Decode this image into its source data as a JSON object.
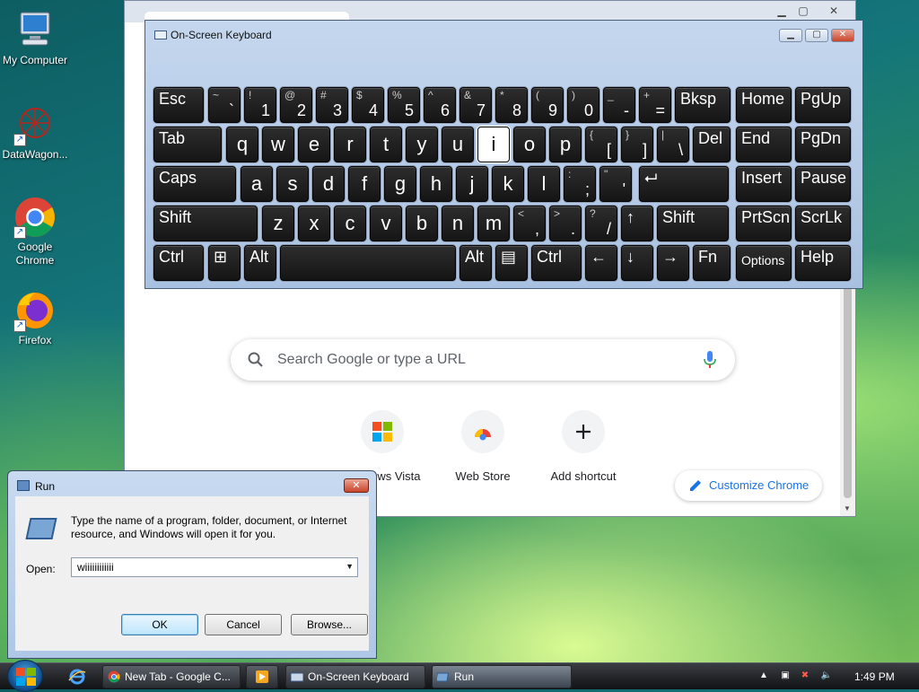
{
  "desktop": {
    "icons": [
      {
        "label": "My Computer"
      },
      {
        "label": "DataWagon..."
      },
      {
        "label": "Google Chrome"
      },
      {
        "label": "Firefox"
      }
    ]
  },
  "chrome": {
    "search_placeholder": "Search Google or type a URL",
    "tiles": [
      {
        "label": "Windows Vista"
      },
      {
        "label": "Web Store"
      },
      {
        "label": "Add shortcut"
      }
    ],
    "customize_label": "Customize Chrome"
  },
  "osk": {
    "title": "On-Screen Keyboard",
    "row1": [
      {
        "l": "Esc"
      },
      {
        "s": "~",
        "m": "`"
      },
      {
        "s": "!",
        "m": "1"
      },
      {
        "s": "@",
        "m": "2"
      },
      {
        "s": "#",
        "m": "3"
      },
      {
        "s": "$",
        "m": "4"
      },
      {
        "s": "%",
        "m": "5"
      },
      {
        "s": "^",
        "m": "6"
      },
      {
        "s": "&",
        "m": "7"
      },
      {
        "s": "*",
        "m": "8"
      },
      {
        "s": "(",
        "m": "9"
      },
      {
        "s": ")",
        "m": "0"
      },
      {
        "s": "_",
        "m": "-"
      },
      {
        "s": "+",
        "m": "="
      },
      {
        "l": "Bksp"
      },
      {
        "l": "Home"
      },
      {
        "l": "PgUp"
      }
    ],
    "row2": [
      {
        "l": "Tab"
      },
      {
        "c": "q"
      },
      {
        "c": "w"
      },
      {
        "c": "e"
      },
      {
        "c": "r"
      },
      {
        "c": "t"
      },
      {
        "c": "y"
      },
      {
        "c": "u"
      },
      {
        "c": "i"
      },
      {
        "c": "o"
      },
      {
        "c": "p"
      },
      {
        "s": "{",
        "m": "["
      },
      {
        "s": "}",
        "m": "]"
      },
      {
        "s": "|",
        "m": "\\"
      },
      {
        "l": "Del"
      },
      {
        "l": "End"
      },
      {
        "l": "PgDn"
      }
    ],
    "row3": [
      {
        "l": "Caps"
      },
      {
        "c": "a"
      },
      {
        "c": "s"
      },
      {
        "c": "d"
      },
      {
        "c": "f"
      },
      {
        "c": "g"
      },
      {
        "c": "h"
      },
      {
        "c": "j"
      },
      {
        "c": "k"
      },
      {
        "c": "l"
      },
      {
        "s": ":",
        "m": ";"
      },
      {
        "s": "\"",
        "m": "'"
      },
      {
        "l": "⮠"
      },
      {
        "l": "Insert"
      },
      {
        "l": "Pause"
      }
    ],
    "row4": [
      {
        "l": "Shift"
      },
      {
        "c": "z"
      },
      {
        "c": "x"
      },
      {
        "c": "c"
      },
      {
        "c": "v"
      },
      {
        "c": "b"
      },
      {
        "c": "n"
      },
      {
        "c": "m"
      },
      {
        "s": "<",
        "m": ","
      },
      {
        "s": ">",
        "m": "."
      },
      {
        "s": "?",
        "m": "/"
      },
      {
        "l": "↑"
      },
      {
        "l": "Shift"
      },
      {
        "l": "PrtScn"
      },
      {
        "l": "ScrLk"
      }
    ],
    "row5": [
      {
        "l": "Ctrl"
      },
      {
        "l": "⊞"
      },
      {
        "l": "Alt"
      },
      {
        "l": ""
      },
      {
        "l": "Alt"
      },
      {
        "l": "▤"
      },
      {
        "l": "Ctrl"
      },
      {
        "l": "←"
      },
      {
        "l": "↓"
      },
      {
        "l": "→"
      },
      {
        "l": "Fn"
      },
      {
        "l": "Options"
      },
      {
        "l": "Help"
      }
    ],
    "active_key": "i"
  },
  "run": {
    "title": "Run",
    "description": "Type the name of a program, folder, document, or Internet resource, and Windows will open it for you.",
    "open_label": "Open:",
    "open_value": "wiiiiiiiiiiii",
    "ok_label": "OK",
    "cancel_label": "Cancel",
    "browse_label": "Browse..."
  },
  "taskbar": {
    "buttons": [
      {
        "label": "New Tab - Google C..."
      },
      {
        "label": "On-Screen Keyboard"
      },
      {
        "label": "Run"
      }
    ],
    "clock": "1:49 PM"
  },
  "colors": {
    "chrome_blue": "#1a73e8",
    "osk_frame": "#a9c1e1",
    "key_face": "#1f1f1f"
  }
}
